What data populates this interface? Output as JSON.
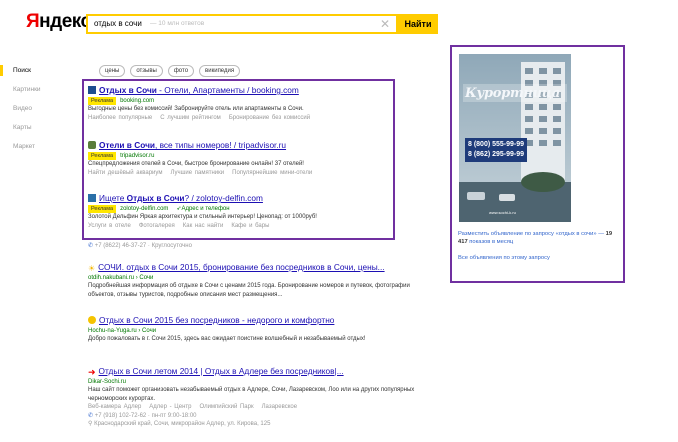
{
  "logo": "Яндекс",
  "search": {
    "query": "отдых в сочи",
    "count": "— 10 млн ответов",
    "button": "Найти"
  },
  "nav": [
    "Поиск",
    "Картинки",
    "Видео",
    "Карты",
    "Маркет"
  ],
  "chips": [
    "цены",
    "отзывы",
    "фото",
    "википедия"
  ],
  "colors": {
    "accent": "#ffcc00",
    "link": "#1c0fb3",
    "url": "#007700",
    "highlight": "#7030a0",
    "ad_tag": "#ffe600"
  },
  "ads": [
    {
      "title_pre": "Отдых в Сочи",
      "title_post": " - Отели, Апартаменты / booking.com",
      "tag": "Реклама",
      "url": "booking.com",
      "snippet": "Выгодные цены без комиссий! Забронируйте отель или апартаменты в Сочи.",
      "sitelinks": [
        "Наиболее популярные",
        "С лучшим рейтингом",
        "Бронирование без комиссий"
      ]
    },
    {
      "title_pre": "Отели в Сочи",
      "title_post": ", все типы номеров! / tripadvisor.ru",
      "tag": "Реклама",
      "url": "tripadvisor.ru",
      "snippet": "Спецпредложения отелей в Сочи, быстрое бронирование онлайн! 37 отелей!",
      "sitelinks": [
        "Найти дешёвый аквариум",
        "Лучшие памятники",
        "Популярнейшие мини-отели"
      ]
    },
    {
      "title_pre": "Ищете ",
      "title_bold": "Отдых в Сочи",
      "title_post": "? / zolotoy-delfin.com",
      "tag": "Реклама",
      "url": "zolotoy-delfin.com",
      "extra": "Адрес и телефон",
      "snippet": "Золотой Дельфин Яркая архитектура и стильный интерьер! Ценопад: от 1000руб!",
      "sitelinks": [
        "Услуги в отеле",
        "Фотогалерея",
        "Как нас найти",
        "Кафе и бары"
      ]
    }
  ],
  "ad_contact": "+7 (8622) 46-37-27 · Круглосуточно",
  "results": [
    {
      "title": "СОЧИ. отдых в Сочи 2015, бронирование без посредников в Сочи, цены...",
      "url": "otdih.nakubani.ru › Сочи",
      "snippet": "Подробнейшая информация об отдыхе в Сочи с ценами 2015 года. Бронирование номеров и путевок, фотографии объектов, отзывы туристов, подробные описания мест размещения..."
    },
    {
      "title": "Отдых в Сочи 2015 без посредников - недорого и комфортно",
      "url": "Hochu-na-Yuga.ru › Сочи",
      "snippet": "Добро пожаловать в г. Сочи 2015, здесь вас ожидает поистине волшебный и незабываемый отдых!"
    },
    {
      "title": "Отдых в Сочи летом 2014 | Отдых в Адлере без посредников|...",
      "url": "Dikar-Sochi.ru",
      "snippet": "Наш сайт поможет организовать незабываемый отдых в Адлере, Сочи, Лазаревском, Лоо или на других популярных черноморских курортах.",
      "sitelinks": [
        "Веб-камера Адлер",
        "Адлер - Центр",
        "Олимпийский Парк",
        "Лазаревское"
      ],
      "phone": "+7 (918) 102-72-62 · пн-пт 9:00-18:00",
      "address": "Краснодарский край, Сочи, микрорайон Адлер, ул. Кирова, 125"
    }
  ],
  "right_ad": {
    "banner_brand": "Курортница",
    "banner_phone1": "8 (800) 555-99-99",
    "banner_phone2": "8 (862) 295-99-99",
    "banner_footer": "www.sochi-k.ru",
    "text_pre": "Разместить объявление по запросу «отдых в сочи» — ",
    "text_bold": "19 417",
    "text_post": " показов в месяц",
    "all_link": "Все объявления по этому запросу"
  }
}
